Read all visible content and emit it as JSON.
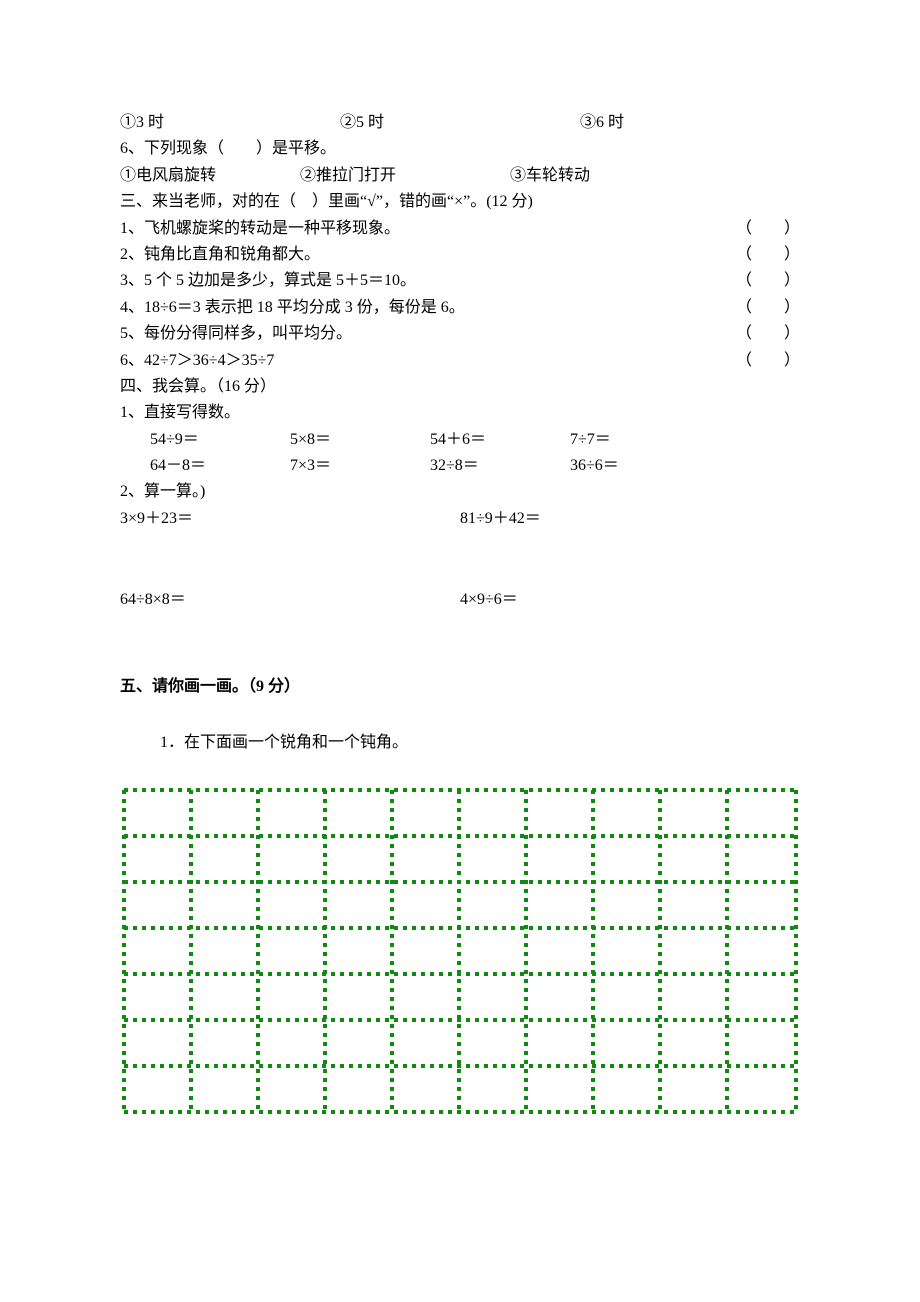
{
  "q_options_5": {
    "o1": "①3 时",
    "o2": "②5 时",
    "o3": "③6 时"
  },
  "q6": "6、下列现象（　　）是平移。",
  "q6_options": {
    "o1": "①电风扇旋转",
    "o2": "②推拉门打开",
    "o3": "③车轮转动"
  },
  "sec3": "三、来当老师，对的在（　）里画“√”，错的画“×”。(12 分)",
  "tf": [
    "1、飞机螺旋桨的转动是一种平移现象。",
    "2、钝角比直角和锐角都大。",
    "3、5 个 5 边加是多少，算式是 5＋5＝10。",
    "4、18÷6＝3 表示把 18 平均分成 3 份，每份是 6。",
    "5、每份分得同样多，叫平均分。",
    "6、42÷7＞36÷4＞35÷7"
  ],
  "paren": "（　　）",
  "sec4": "四、我会算。（16 分）",
  "sec4_1": "1、直接写得数。",
  "calc1": [
    "54÷9＝",
    "5×8＝",
    "54＋6＝",
    "7÷7＝"
  ],
  "calc2": [
    "64－8＝",
    "7×3＝",
    "32÷8＝",
    "36÷6＝"
  ],
  "sec4_2": "2、算一算。)",
  "pair1": {
    "l": "3×9＋23＝",
    "r": "81÷9＋42＝"
  },
  "pair2": {
    "l": "64÷8×8＝",
    "r": "4×9÷6＝"
  },
  "sec5": "五、请你画一画。（9 分）",
  "sec5_1": "1．在下面画一个锐角和一个钝角。"
}
